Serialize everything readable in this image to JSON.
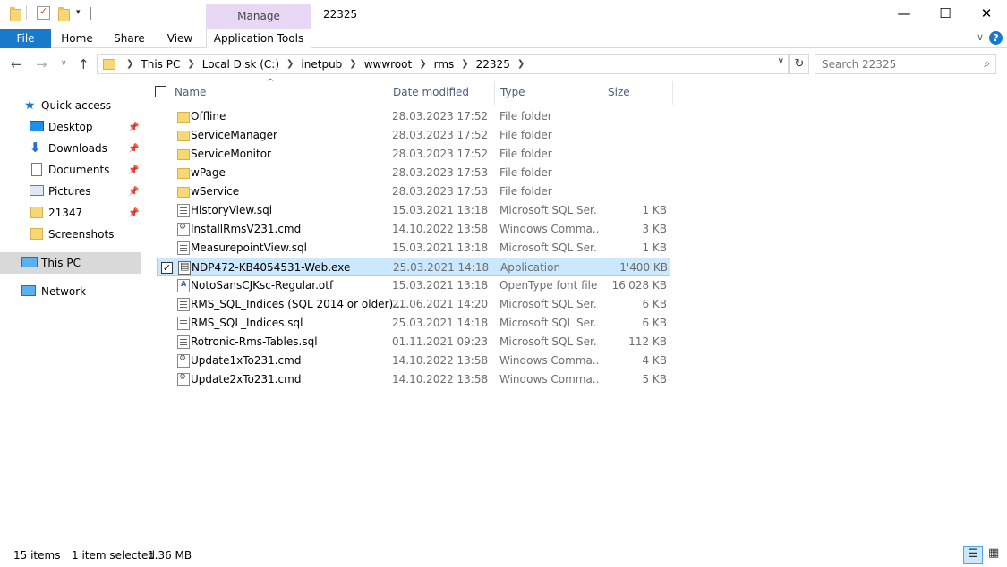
{
  "window": {
    "title": "22325",
    "manage_label": "Manage",
    "minimize": "—",
    "maximize": "☐",
    "close": "✕"
  },
  "ribbon": {
    "tabs": [
      "File",
      "Home",
      "Share",
      "View",
      "Application Tools"
    ],
    "help": "?"
  },
  "address": {
    "crumbs": [
      "This PC",
      "Local Disk (C:)",
      "inetpub",
      "wwwroot",
      "rms",
      "22325"
    ],
    "search_placeholder": "Search 22325"
  },
  "nav": {
    "quick_access": "Quick access",
    "items": [
      {
        "label": "Desktop",
        "pinned": true,
        "icon": "desktop-icon"
      },
      {
        "label": "Downloads",
        "pinned": true,
        "icon": "download-icon"
      },
      {
        "label": "Documents",
        "pinned": true,
        "icon": "documents-icon"
      },
      {
        "label": "Pictures",
        "pinned": true,
        "icon": "pictures-icon"
      },
      {
        "label": "21347",
        "pinned": true,
        "icon": "folder-icon"
      },
      {
        "label": "Screenshots",
        "pinned": false,
        "icon": "folder-icon"
      }
    ],
    "this_pc": "This PC",
    "network": "Network"
  },
  "columns": {
    "name": "Name",
    "date": "Date modified",
    "type": "Type",
    "size": "Size"
  },
  "files": [
    {
      "name": "Offline",
      "date": "28.03.2023 17:52",
      "type": "File folder",
      "size": "",
      "icon": "folder"
    },
    {
      "name": "ServiceManager",
      "date": "28.03.2023 17:52",
      "type": "File folder",
      "size": "",
      "icon": "folder"
    },
    {
      "name": "ServiceMonitor",
      "date": "28.03.2023 17:52",
      "type": "File folder",
      "size": "",
      "icon": "folder"
    },
    {
      "name": "wPage",
      "date": "28.03.2023 17:53",
      "type": "File folder",
      "size": "",
      "icon": "folder"
    },
    {
      "name": "wService",
      "date": "28.03.2023 17:53",
      "type": "File folder",
      "size": "",
      "icon": "folder"
    },
    {
      "name": "HistoryView.sql",
      "date": "15.03.2021 13:18",
      "type": "Microsoft SQL Ser...",
      "size": "1 KB",
      "icon": "doc"
    },
    {
      "name": "InstallRmsV231.cmd",
      "date": "14.10.2022 13:58",
      "type": "Windows Comma...",
      "size": "3 KB",
      "icon": "cmd"
    },
    {
      "name": "MeasurepointView.sql",
      "date": "15.03.2021 13:18",
      "type": "Microsoft SQL Ser...",
      "size": "1 KB",
      "icon": "doc"
    },
    {
      "name": "NDP472-KB4054531-Web.exe",
      "date": "25.03.2021 14:18",
      "type": "Application",
      "size": "1'400 KB",
      "icon": "exe",
      "selected": true
    },
    {
      "name": "NotoSansCJKsc-Regular.otf",
      "date": "15.03.2021 13:18",
      "type": "OpenType font file",
      "size": "16'028 KB",
      "icon": "font"
    },
    {
      "name": "RMS_SQL_Indices (SQL 2014 or older)....",
      "date": "21.06.2021 14:20",
      "type": "Microsoft SQL Ser...",
      "size": "6 KB",
      "icon": "doc"
    },
    {
      "name": "RMS_SQL_Indices.sql",
      "date": "25.03.2021 14:18",
      "type": "Microsoft SQL Ser...",
      "size": "6 KB",
      "icon": "doc"
    },
    {
      "name": "Rotronic-Rms-Tables.sql",
      "date": "01.11.2021 09:23",
      "type": "Microsoft SQL Ser...",
      "size": "112 KB",
      "icon": "doc"
    },
    {
      "name": "Update1xTo231.cmd",
      "date": "14.10.2022 13:58",
      "type": "Windows Comma...",
      "size": "4 KB",
      "icon": "cmd"
    },
    {
      "name": "Update2xTo231.cmd",
      "date": "14.10.2022 13:58",
      "type": "Windows Comma...",
      "size": "5 KB",
      "icon": "cmd"
    }
  ],
  "status": {
    "count": "15 items",
    "selected": "1 item selected",
    "size": "1.36 MB"
  }
}
